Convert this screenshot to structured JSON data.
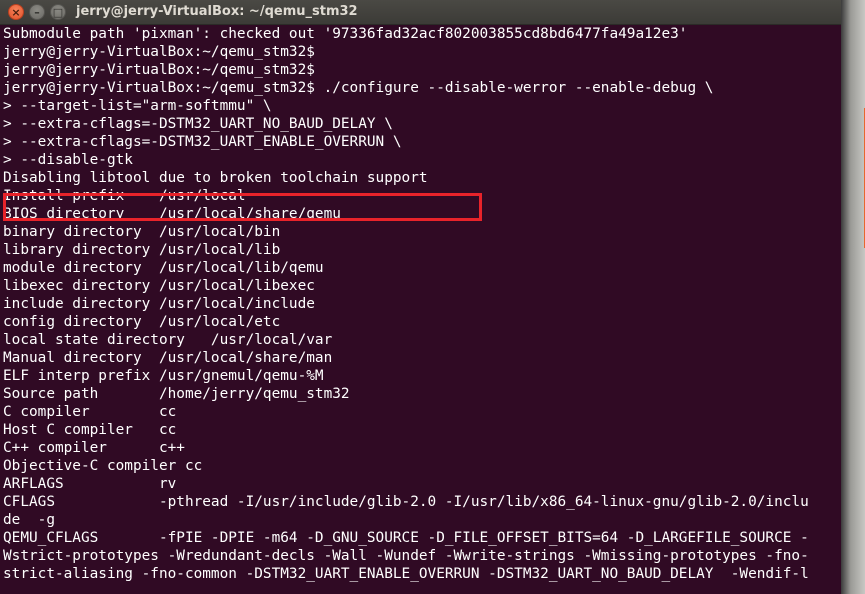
{
  "window": {
    "title": "jerry@jerry-VirtualBox: ~/qemu_stm32",
    "close_symbol": "×",
    "minimize_symbol": "–",
    "maximize_symbol": "□"
  },
  "colors": {
    "terminal_background": "#300a24",
    "terminal_text": "#ffffff",
    "highlight_box": "#e8232a",
    "scroll_thumb": "#e8672e"
  },
  "terminal": {
    "lines": [
      "Submodule path 'pixman': checked out '97336fad32acf802003855cd8bd6477fa49a12e3'",
      "jerry@jerry-VirtualBox:~/qemu_stm32$",
      "jerry@jerry-VirtualBox:~/qemu_stm32$",
      "jerry@jerry-VirtualBox:~/qemu_stm32$ ./configure --disable-werror --enable-debug \\",
      "> --target-list=\"arm-softmmu\" \\",
      "> --extra-cflags=-DSTM32_UART_NO_BAUD_DELAY \\",
      "> --extra-cflags=-DSTM32_UART_ENABLE_OVERRUN \\",
      "> --disable-gtk",
      "Disabling libtool due to broken toolchain support",
      "Install prefix    /usr/local",
      "BIOS directory    /usr/local/share/qemu",
      "binary directory  /usr/local/bin",
      "library directory /usr/local/lib",
      "module directory  /usr/local/lib/qemu",
      "libexec directory /usr/local/libexec",
      "include directory /usr/local/include",
      "config directory  /usr/local/etc",
      "local state directory   /usr/local/var",
      "Manual directory  /usr/local/share/man",
      "ELF interp prefix /usr/gnemul/qemu-%M",
      "Source path       /home/jerry/qemu_stm32",
      "C compiler        cc",
      "Host C compiler   cc",
      "C++ compiler      c++",
      "Objective-C compiler cc",
      "ARFLAGS           rv",
      "CFLAGS            -pthread -I/usr/include/glib-2.0 -I/usr/lib/x86_64-linux-gnu/glib-2.0/inclu",
      "de  -g",
      "QEMU_CFLAGS       -fPIE -DPIE -m64 -D_GNU_SOURCE -D_FILE_OFFSET_BITS=64 -D_LARGEFILE_SOURCE -",
      "Wstrict-prototypes -Wredundant-decls -Wall -Wundef -Wwrite-strings -Wmissing-prototypes -fno-",
      "strict-aliasing -fno-common -DSTM32_UART_ENABLE_OVERRUN -DSTM32_UART_NO_BAUD_DELAY  -Wendif-l"
    ]
  }
}
